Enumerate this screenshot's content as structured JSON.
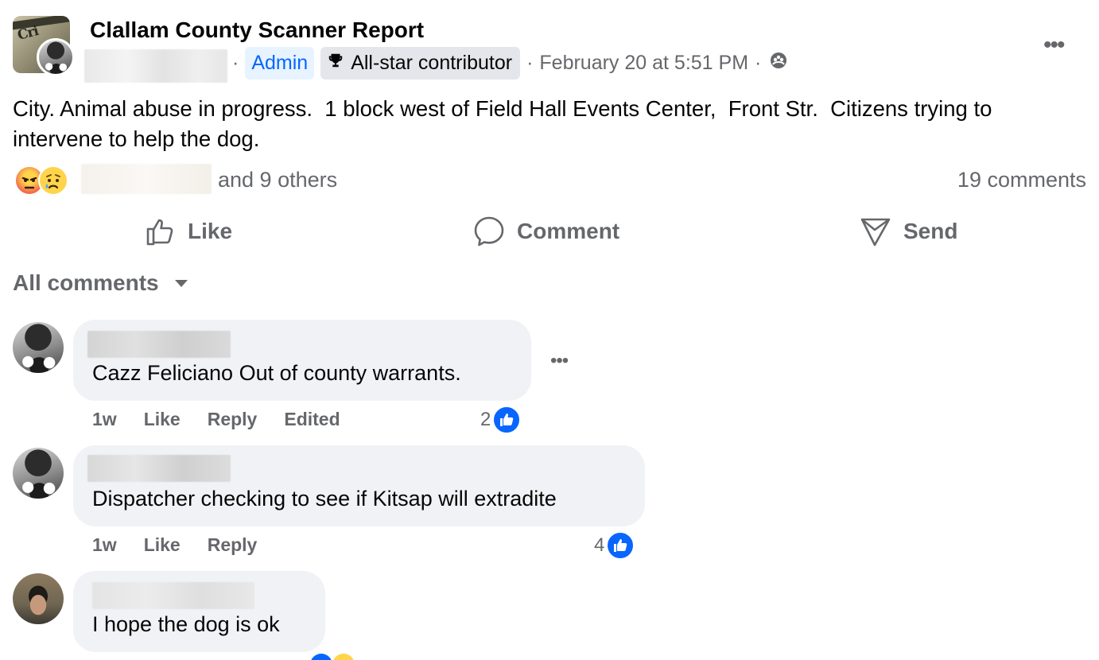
{
  "post": {
    "group_name": "Clallam County Scanner Report",
    "admin_label": "Admin",
    "allstar_label": "All-star contributor",
    "timestamp": "February 20 at 5:51 PM",
    "body": "City. Animal abuse in progress.  1 block west of Field Hall Events Center,  Front Str.  Citizens trying to intervene to help the dog.",
    "avatar_text": "Cri",
    "more_icon": "ellipsis-icon"
  },
  "reactions": {
    "others_text": "and 9 others",
    "comments_count": "19 comments",
    "types": [
      "angry",
      "sad"
    ]
  },
  "actions": {
    "like": "Like",
    "comment": "Comment",
    "send": "Send"
  },
  "comments_header": {
    "label": "All comments"
  },
  "comments": [
    {
      "text": "Cazz Feliciano Out of county warrants.",
      "time": "1w",
      "like": "Like",
      "reply": "Reply",
      "edited": "Edited",
      "likes": "2"
    },
    {
      "text": "Dispatcher checking to see if Kitsap will extradite",
      "time": "1w",
      "like": "Like",
      "reply": "Reply",
      "likes": "4"
    },
    {
      "text": "I hope the dog is ok"
    }
  ],
  "colors": {
    "accent": "#0866ff",
    "secondary_text": "#65676b",
    "bubble": "#f0f2f5"
  }
}
